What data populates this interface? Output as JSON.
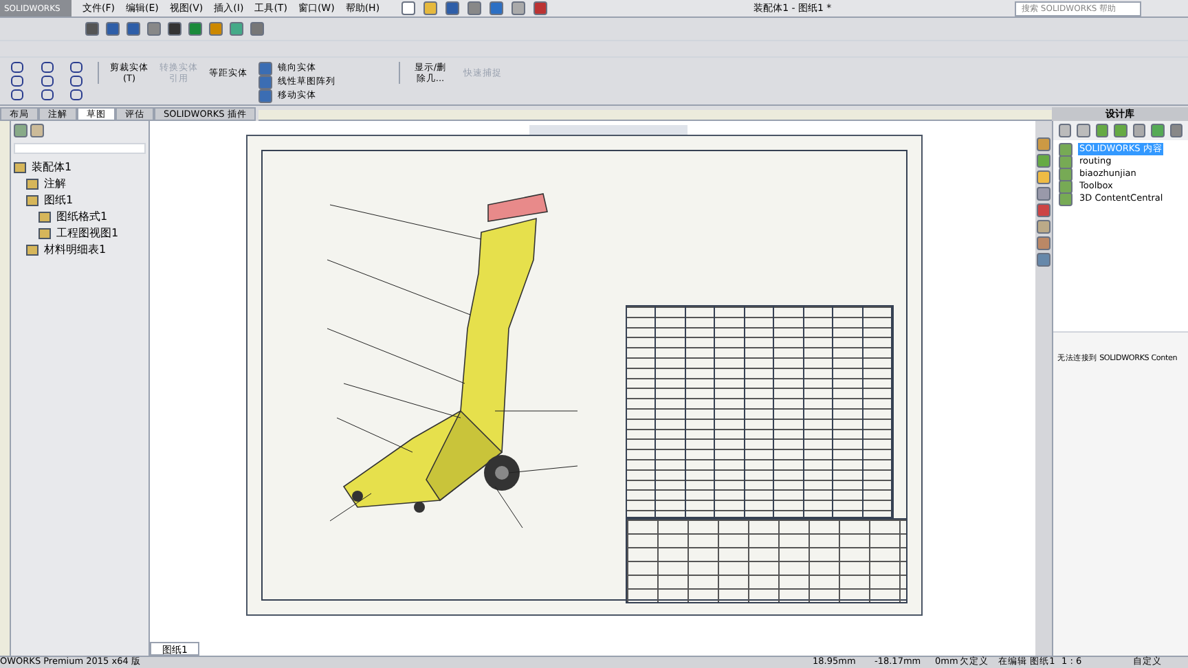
{
  "menu_bar": {
    "logo": "SOLIDWORKS",
    "menus": [
      "文件(F)",
      "编辑(E)",
      "视图(V)",
      "插入(I)",
      "工具(T)",
      "窗口(W)",
      "帮助(H)"
    ],
    "document_title": "装配体1 - 图纸1 *",
    "search": {
      "placeholder": "搜索 SOLIDWORKS 帮助"
    }
  },
  "command_manager": {
    "big_tools": [
      {
        "label": "剪裁实体(T)",
        "disabled": false
      },
      {
        "label": "转换实体引用",
        "disabled": true
      },
      {
        "label": "等距实体",
        "disabled": false
      }
    ],
    "small_tools": [
      "镜向实体",
      "线性草图阵列",
      "移动实体"
    ],
    "more_tools": [
      {
        "label": "显示/删除几...",
        "disabled": false
      },
      {
        "label": "快速捕捉",
        "disabled": true
      }
    ]
  },
  "tabs": [
    {
      "label": "布局",
      "selected": false
    },
    {
      "label": "注解",
      "selected": false
    },
    {
      "label": "草图",
      "selected": true
    },
    {
      "label": "评估",
      "selected": false
    },
    {
      "label": "SOLIDWORKS 插件",
      "selected": false
    }
  ],
  "feature_tree": [
    {
      "label": "装配体1",
      "children": [
        {
          "label": "注解"
        },
        {
          "label": "图纸1",
          "children": [
            {
              "label": "图纸格式1"
            },
            {
              "label": "工程图视图1"
            }
          ]
        },
        {
          "label": "材料明细表1"
        }
      ]
    }
  ],
  "design_library": {
    "title": "设计库",
    "items": [
      {
        "label": "SOLIDWORKS 内容",
        "selected": true
      },
      {
        "label": "routing",
        "selected": false
      },
      {
        "label": "biaozhunjian",
        "selected": false
      },
      {
        "label": "Toolbox",
        "selected": false
      },
      {
        "label": "3D ContentCentral",
        "selected": false
      }
    ],
    "message": "无法连接到 SOLIDWORKS Conten"
  },
  "sheet_tabs": [
    {
      "label": "图纸1",
      "selected": true
    }
  ],
  "status_bar": {
    "product": "OWORKS Premium 2015 x64 版",
    "x": "18.95mm",
    "y": "-18.17mm",
    "z": "0mm",
    "state": "欠定义",
    "mode": "在编辑 图纸1",
    "scale": "1 : 6",
    "units": "自定义"
  }
}
